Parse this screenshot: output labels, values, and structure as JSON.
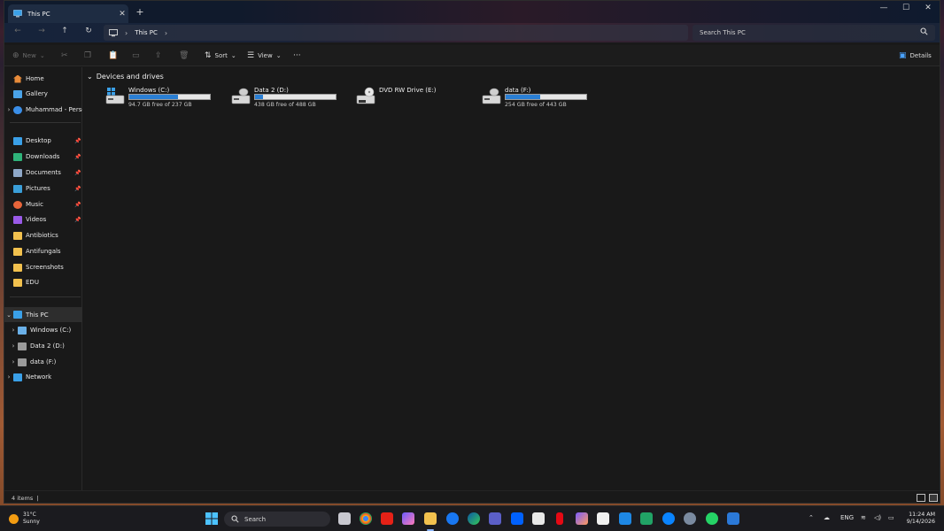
{
  "window": {
    "tab_title": "This PC",
    "tab_close": "✕",
    "new_tab": "+",
    "minimize": "—",
    "maximize": "☐",
    "close": "✕"
  },
  "nav": {
    "back": "←",
    "forward": "→",
    "up": "↑",
    "refresh": "↻",
    "address_crumb": "This PC",
    "chevron": "›",
    "search_placeholder": "Search This PC"
  },
  "toolbar": {
    "new_label": "New",
    "sort_label": "Sort",
    "view_label": "View",
    "more": "···",
    "details_label": "Details"
  },
  "sidebar": {
    "home": "Home",
    "gallery": "Gallery",
    "onedrive": "Muhammad - Personal",
    "quick": [
      "Desktop",
      "Downloads",
      "Documents",
      "Pictures",
      "Music",
      "Videos"
    ],
    "folders": [
      "Antibiotics",
      "Antifungals",
      "Screenshots",
      "EDU"
    ],
    "this_pc": "This PC",
    "drives": [
      "Windows (C:)",
      "Data 2 (D:)",
      "data (F:)"
    ],
    "network": "Network"
  },
  "content": {
    "group_title": "Devices and drives",
    "drives": [
      {
        "name": "Windows (C:)",
        "free_text": "94.7 GB free of 237 GB",
        "used_fraction": 0.6
      },
      {
        "name": "Data 2 (D:)",
        "free_text": "438 GB free of 488 GB",
        "used_fraction": 0.1
      },
      {
        "name": "DVD RW Drive (E:)",
        "free_text": "",
        "used_fraction": null
      },
      {
        "name": "data (F:)",
        "free_text": "254 GB free of 443 GB",
        "used_fraction": 0.43
      }
    ]
  },
  "status": {
    "items_text": "4 items",
    "separator": "|"
  },
  "taskbar": {
    "temperature": "31°C",
    "weather": "Sunny",
    "search": "Search",
    "language": "ENG",
    "time": "11:24 AM",
    "date": "9/14/2026"
  },
  "colors": {
    "accent": "#2a7fd4",
    "folder": "#f2c14e",
    "window_bg": "#191919"
  }
}
